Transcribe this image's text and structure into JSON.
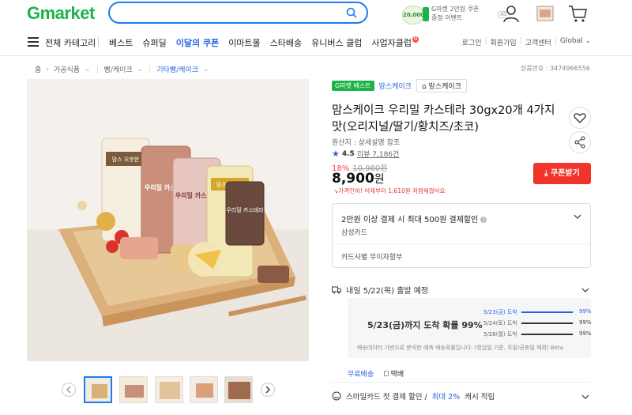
{
  "header": {
    "logo_g": "G",
    "logo_rest": "market",
    "search": {
      "placeholder": ""
    },
    "promo": {
      "coin": "20,000",
      "text": "G마켓 2만원 쿠폰 증정 이벤트",
      "ad": "AD"
    }
  },
  "nav": {
    "all_categories": "전체 카테고리",
    "items": [
      "베스트",
      "슈퍼딜",
      "이달의 쿠폰",
      "이마트몰",
      "스타배송",
      "유니버스 클럽",
      "사업자클럽"
    ],
    "highlighted_item": "이달의 쿠폰",
    "right": [
      "로그인",
      "회원가입",
      "고객센터",
      "Global"
    ]
  },
  "breadcrumb": {
    "home": "홈",
    "items": [
      "가공식품",
      "빵/케이크",
      "기타빵/케이크"
    ],
    "product_no": "상품번호 : 3474966556"
  },
  "product": {
    "badge": "G마켓 베스트",
    "shop": "맘스케이크",
    "store_button": "맘스케이크",
    "title": "맘스케이크 우리밀 카스테라 30gx20개 4가지맛(오리지널/딸기/황치즈/초코)",
    "origin": "원산지 : 상세설명 참조",
    "rating": "4.5",
    "review_label": "리뷰",
    "review_count": "7,186건",
    "discount_pct": "18%",
    "original_price": "10,980원",
    "price": "8,900",
    "price_unit": "원",
    "price_note": "가격인하! 어제부터 1,610원 저렴해졌어요",
    "coupon_button": "쿠폰받기",
    "image_labels": [
      "맘스 오붓한",
      "우리밀 카스테라",
      "우리밀 카스테라",
      "맘스 오붓한",
      "우리밀 카스테라"
    ]
  },
  "benefit": {
    "title": "2만원 이상 결제 시 최대 500원 결제할인",
    "sub": "삼성카드",
    "card_installment": "카드사별 무이자할부"
  },
  "shipping": {
    "headline": "내일 5/22(목) 출발 예정",
    "probability": "5/23(금)까지 도착 확률 99%",
    "rows": [
      {
        "date": "5/23(금) 도착",
        "pct_text": "99%",
        "pct": 99
      },
      {
        "date": "5/24(토) 도착",
        "pct_text": "99%",
        "pct": 99
      },
      {
        "date": "5/26(월) 도착",
        "pct_text": "99%",
        "pct": 99
      }
    ],
    "note": "배송데이터 기반으로 분석한 예측 배송확률입니다. (영업일 기준, 주말/공휴일 제외) Beta",
    "free": "무료배송",
    "parcel": "택배"
  },
  "smile": {
    "text_a": "스마일카드 첫 결제 할인 /",
    "text_b": "최대 2%",
    "text_c": "캐시 적립"
  },
  "colors": {
    "brand_green": "#1db34a",
    "accent_blue": "#1b7bf2",
    "coupon_red": "#f0342c"
  }
}
